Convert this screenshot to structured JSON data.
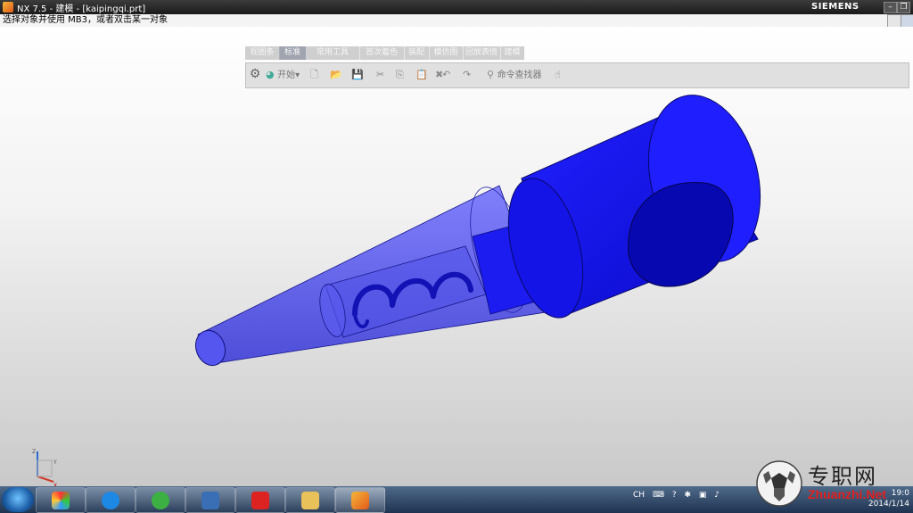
{
  "window": {
    "title": "NX 7.5 - 建模 - [kaipingqi.prt]",
    "brand": "SIEMENS",
    "minimize": "–",
    "restore": "❐",
    "close": "✕"
  },
  "cue_line": "选择对象并使用 MB3，或者双击某一对象",
  "ribbon": {
    "tabs": [
      "视图条",
      "标准",
      "常用工具",
      "首次着色",
      "装配",
      "模仿图",
      "回放表情",
      "建模"
    ],
    "active_tab": "标准"
  },
  "toolbar": {
    "start_label": "开始",
    "command_finder_label": "命令查找器"
  },
  "triad": {
    "x_label": "X",
    "y_label": "Y",
    "z_label": "Z"
  },
  "taskbar": {
    "tray_lang": "CH",
    "clock_time": "19:0",
    "clock_date": "2014/1/14"
  },
  "watermark": {
    "text": "专职网",
    "url": "Zhuanzhi.Net"
  },
  "colors": {
    "model_blue": "#1a1aff",
    "model_translucent": "#3a3ae0"
  }
}
